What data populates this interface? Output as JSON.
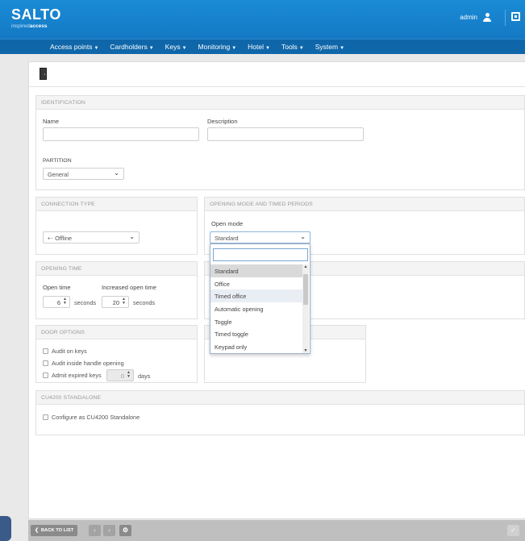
{
  "header": {
    "brand": "SALTO",
    "tagline_prefix": "inspired",
    "tagline_suffix": "access",
    "user": "admin"
  },
  "nav": [
    {
      "label": "Access points"
    },
    {
      "label": "Cardholders"
    },
    {
      "label": "Keys"
    },
    {
      "label": "Monitoring"
    },
    {
      "label": "Hotel"
    },
    {
      "label": "Tools"
    },
    {
      "label": "System"
    }
  ],
  "identification": {
    "heading": "IDENTIFICATION",
    "name_label": "Name",
    "name_value": "",
    "description_label": "Description",
    "description_value": "",
    "partition_label": "PARTITION",
    "partition_value": "General"
  },
  "connection_type": {
    "heading": "CONNECTION TYPE",
    "value": "Offline"
  },
  "opening_mode": {
    "heading": "OPENING MODE AND TIMED PERIODS",
    "open_mode_label": "Open mode",
    "open_mode_value": "Standard",
    "search_value": "",
    "options": [
      "Standard",
      "Office",
      "Timed office",
      "Automatic opening",
      "Toggle",
      "Timed toggle",
      "Keypad only"
    ],
    "selected_option": "Standard",
    "hovered_option": "Timed office"
  },
  "opening_time": {
    "heading": "OPENING TIME",
    "open_time_label": "Open time",
    "open_time_value": "6",
    "open_time_unit": "seconds",
    "increased_label": "Increased open time",
    "increased_value": "20",
    "increased_unit": "seconds"
  },
  "door_options": {
    "heading": "DOOR OPTIONS",
    "audit_on_keys": "Audit on keys",
    "audit_inside": "Audit inside handle opening",
    "admit_expired": "Admit expired keys",
    "admit_value": "0",
    "admit_unit": "days"
  },
  "cu4200": {
    "heading": "CU4200 STANDALONE",
    "configure": "Configure as CU4200 Standalone"
  },
  "footer": {
    "back_label": "BACK TO LIST",
    "prev_glyph": "‹",
    "next_glyph": "›",
    "gear_glyph": "⚙",
    "ok_glyph": "✓"
  },
  "icons": {
    "user": "user-icon",
    "logout": "logout-icon",
    "door": "door-icon",
    "settings": "gear-icon"
  },
  "colors": {
    "header_blue": "#1a8bd6",
    "nav_blue": "#0f67aa"
  }
}
